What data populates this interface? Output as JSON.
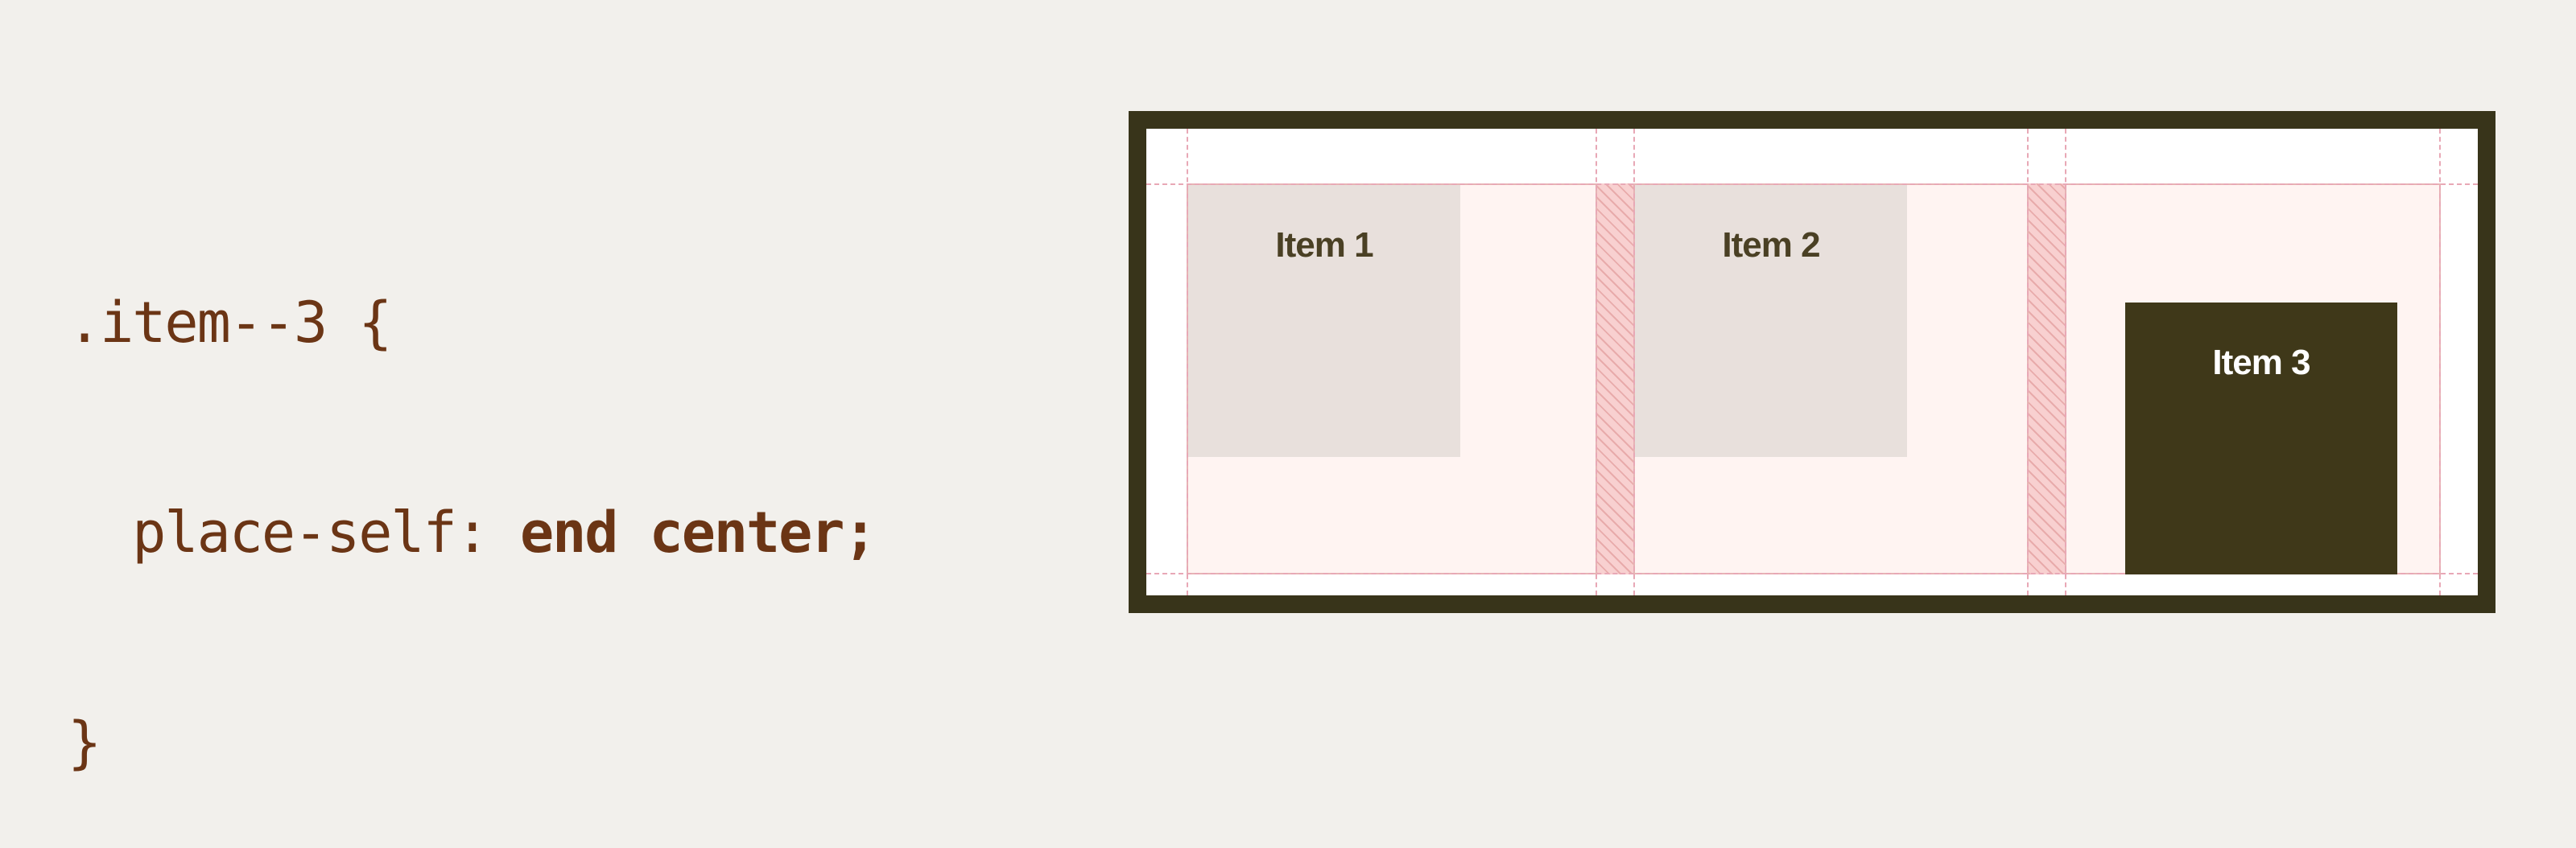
{
  "code": {
    "line1": ".item--3 {",
    "line2_prop": "  place-self: ",
    "line2_value": "end center;",
    "line3": "}"
  },
  "items": [
    {
      "label": "Item 1"
    },
    {
      "label": "Item 2"
    },
    {
      "label": "Item 3"
    }
  ],
  "colors": {
    "background": "#f2f0ec",
    "code_text": "#6b3515",
    "container_border": "#38341a",
    "grid_area": "#fff4f2",
    "gap_hatch": "#f8d0d0",
    "item_muted": "#e8e0dc",
    "item_highlight": "#3f3819"
  }
}
